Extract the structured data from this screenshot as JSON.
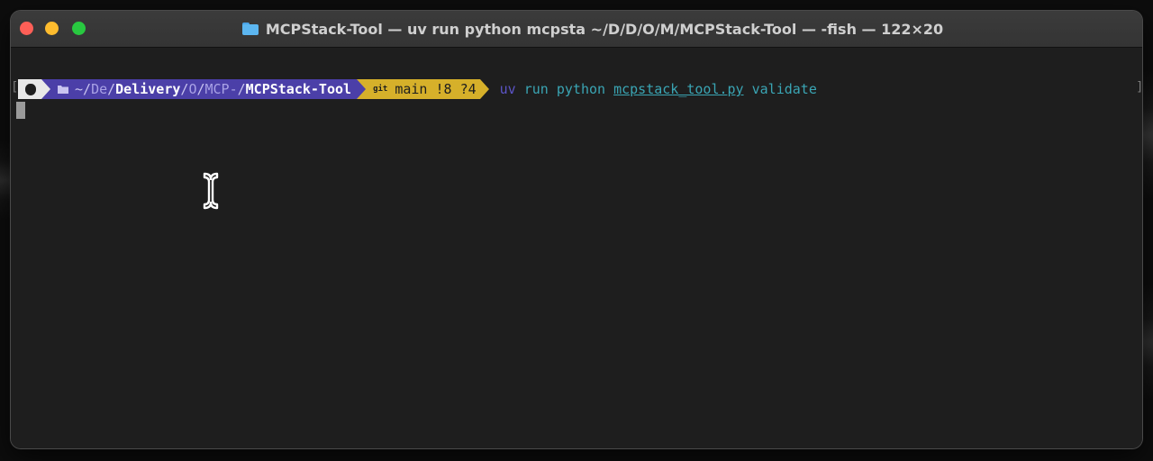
{
  "window": {
    "title": "MCPStack-Tool — uv run python mcpsta ~/D/D/O/M/MCPStack-Tool — -fish — 122×20",
    "icon": "folder-icon"
  },
  "traffic_lights": {
    "close_color": "#fe5f57",
    "minimize_color": "#febc2e",
    "maximize_color": "#28c840"
  },
  "terminal": {
    "brackets": {
      "left": "[",
      "right": "]"
    },
    "prompt": {
      "path_home": "~/",
      "path_de": "De",
      "sep1": "/",
      "path_delivery": "Delivery",
      "sep2": "/",
      "path_o": "O",
      "sep3": "/",
      "path_mcp": "MCP-",
      "sep4": "/",
      "path_current": "MCPStack-Tool",
      "git_glyph": "git",
      "git_status": "main !8 ?4"
    },
    "command": {
      "uv": "uv",
      "run": "run python",
      "file": "mcpstack_tool.py",
      "arg": "validate"
    },
    "colors": {
      "path_bg": "#4b3fa8",
      "git_bg": "#d6b02a",
      "command": "#3aa5b4"
    }
  }
}
